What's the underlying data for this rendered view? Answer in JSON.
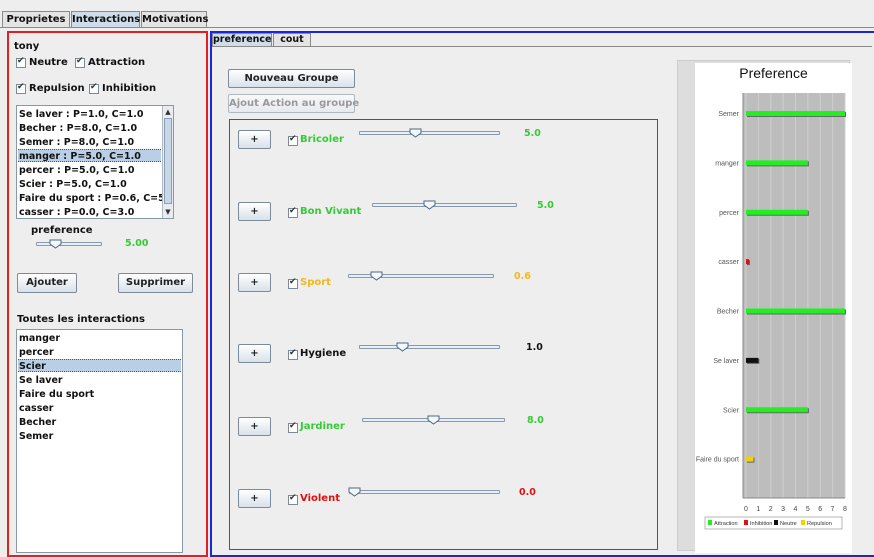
{
  "tabs": [
    {
      "label": "Proprietes"
    },
    {
      "label": "Interactions"
    },
    {
      "label": "Motivations"
    }
  ],
  "left": {
    "character_name": "tony",
    "filters": [
      {
        "label": "Neutre",
        "checked": true
      },
      {
        "label": "Attraction",
        "checked": true
      },
      {
        "label": "Repulsion",
        "checked": true
      },
      {
        "label": "Inhibition",
        "checked": true
      }
    ],
    "interactions": [
      "Se laver :  P=1.0, C=1.0",
      "Becher :  P=8.0, C=1.0",
      "Semer :  P=8.0, C=1.0",
      "manger :  P=5.0, C=1.0",
      "percer :  P=5.0, C=1.0",
      "Scier :  P=5.0, C=1.0",
      "Faire du sport :  P=0.6, C=5.0",
      "casser :  P=0.0, C=3.0"
    ],
    "selected_interaction_index": 3,
    "preference_label": "preference",
    "preference_value": "5.00",
    "preference_level": 0.31,
    "add_button": "Ajouter",
    "remove_button": "Supprimer",
    "all_interactions_title": "Toutes les interactions",
    "all_interactions": [
      "manger",
      "percer",
      "Scier",
      "Se laver",
      "Faire du sport",
      "casser",
      "Becher",
      "Semer"
    ],
    "selected_all_index": 2
  },
  "right": {
    "subtabs": [
      {
        "label": "preference"
      },
      {
        "label": "cout"
      }
    ],
    "new_group_button": "Nouveau Groupe",
    "add_action_button": "Ajout Action au groupe",
    "motivations": [
      {
        "plus": "+",
        "name": "Bricoler",
        "value": "5.0",
        "level": 0.36,
        "color": "#33cc33",
        "value_color": "#33cc33"
      },
      {
        "plus": "+",
        "name": "Bon Vivant",
        "value": "5.0",
        "level": 0.36,
        "color": "#33cc33",
        "value_color": "#33cc33"
      },
      {
        "plus": "+",
        "name": "Sport",
        "value": "0.6",
        "level": 0.16,
        "color": "#f2b81c",
        "value_color": "#f2b81c"
      },
      {
        "plus": "+",
        "name": "Hygiene",
        "value": "1.0",
        "level": 0.27,
        "color": "#111111",
        "value_color": "#111111"
      },
      {
        "plus": "+",
        "name": "Jardiner",
        "value": "8.0",
        "level": 0.46,
        "color": "#33cc33",
        "value_color": "#33cc33"
      },
      {
        "plus": "+",
        "name": "Violent",
        "value": "0.0",
        "level": 0.0,
        "color": "#dd1111",
        "value_color": "#dd1111"
      }
    ]
  },
  "chart_data": {
    "type": "bar",
    "title": "Preference",
    "orientation": "horizontal",
    "categories": [
      "Semer",
      "manger",
      "percer",
      "casser",
      "Becher",
      "Se laver",
      "Scier",
      "Faire du sport"
    ],
    "values": [
      8,
      5,
      5,
      0.1,
      8,
      1,
      5,
      0.6
    ],
    "bar_colors": [
      "#22ee22",
      "#22ee22",
      "#22ee22",
      "#dd1111",
      "#22ee22",
      "#111111",
      "#22ee22",
      "#f2d200"
    ],
    "xlim": [
      0,
      8
    ],
    "x_ticks": [
      "0",
      "1",
      "2",
      "3",
      "4",
      "5",
      "6",
      "7",
      "8"
    ],
    "grid": true,
    "legend_position": "bottom",
    "legend": [
      {
        "name": "Attraction",
        "color": "#22ee22"
      },
      {
        "name": "Inhibition",
        "color": "#dd1111"
      },
      {
        "name": "Neutre",
        "color": "#111111"
      },
      {
        "name": "Repulsion",
        "color": "#f2d200"
      }
    ]
  }
}
